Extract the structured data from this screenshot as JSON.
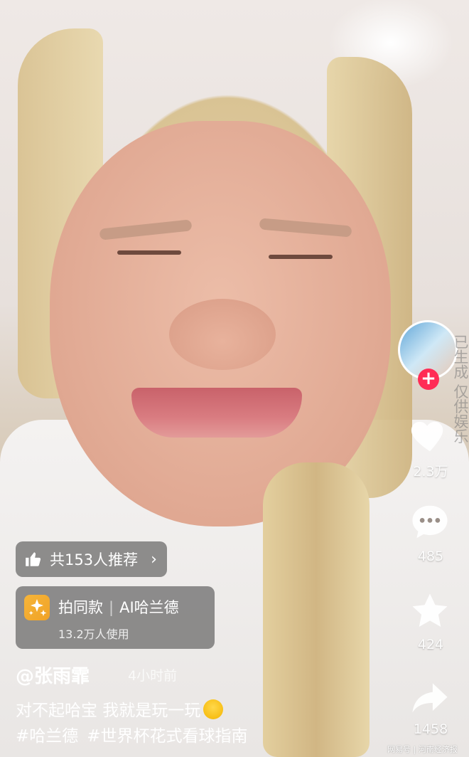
{
  "rail": {
    "watermark": "已生成 仅供娱乐",
    "like_count": "2.3万",
    "comment_count": "485",
    "favorite_count": "424",
    "share_count": "1458"
  },
  "recommend": {
    "label": "共153人推荐"
  },
  "effect": {
    "action": "拍同款",
    "name": "AI哈兰德",
    "usage": "13.2万人使用"
  },
  "post": {
    "author": "@张雨霏",
    "time": "4小时前",
    "caption": "对不起哈宝 我就是玩一玩",
    "tags": [
      "#哈兰德",
      "#世界杯花式看球指南"
    ]
  },
  "footer": {
    "source": "网易号 | 河南经济报"
  },
  "colors": {
    "follow": "#ff2c55",
    "effect_icon": "#f4ad2e"
  },
  "icons": [
    "thumbs-up-icon",
    "sparkle-icon",
    "heart-icon",
    "comment-icon",
    "star-icon",
    "share-icon",
    "plus-icon"
  ]
}
